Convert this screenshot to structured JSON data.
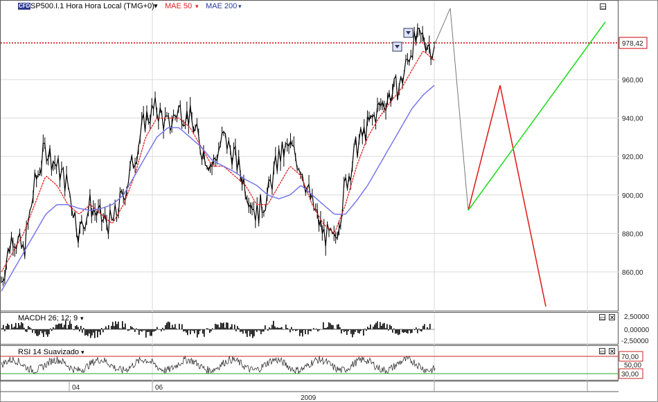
{
  "header": {
    "badge": "CFD",
    "symbol": "SP500.I.1 Hora Hora Local (TMG+0)",
    "ma1": "MAE 50",
    "ma2": "MAE 200"
  },
  "colors": {
    "price": "#000000",
    "ma50": "#e02020",
    "ma200": "#7777ee",
    "grid": "#d8d8d8",
    "current_line": "#cc0000",
    "grey_projection": "#777777",
    "red_projection": "#e02020",
    "green_projection": "#22dd22",
    "rsi_band_high": "#cc2222",
    "rsi_band_low": "#22aa22"
  },
  "price_panel": {
    "current_price": "978,42",
    "y_ticks": [
      "960,00",
      "940,00",
      "920,00",
      "900,00",
      "880,00",
      "860,00"
    ],
    "ylim": [
      845,
      1000
    ]
  },
  "macd_panel": {
    "title": "MACDH 26; 12; 9",
    "y_ticks": [
      "2,50000",
      "0,00000",
      "-2,50000"
    ]
  },
  "rsi_panel": {
    "title": "RSI 14 Suavizado",
    "y_ticks": [
      "70,00",
      "50,00",
      "30,00"
    ],
    "band_high": 70,
    "band_low": 30
  },
  "x_axis": {
    "ticks": [
      "04",
      "06"
    ],
    "year": "2009"
  },
  "chart_data": {
    "type": "line",
    "title": "SP500.I.1 Hora Hora Local (TMG+0)",
    "series": [
      {
        "name": "SP500.I.1",
        "values": [
          855,
          880,
          870,
          905,
          925,
          915,
          905,
          880,
          895,
          887,
          885,
          900,
          920,
          940,
          945,
          935,
          945,
          940,
          925,
          915,
          930,
          920,
          905,
          890,
          900,
          920,
          925,
          915,
          895,
          880,
          875,
          905,
          925,
          935,
          945,
          952,
          958,
          978,
          982,
          975
        ]
      },
      {
        "name": "MAE 50",
        "values": [
          860,
          870,
          880,
          895,
          910,
          905,
          895,
          890,
          895,
          890,
          885,
          895,
          910,
          930,
          940,
          940,
          940,
          935,
          925,
          915,
          915,
          910,
          905,
          895,
          895,
          905,
          915,
          910,
          895,
          885,
          880,
          895,
          915,
          930,
          940,
          948,
          955,
          965,
          975,
          970
        ]
      },
      {
        "name": "MAE 200",
        "values": [
          850,
          860,
          870,
          880,
          890,
          895,
          895,
          893,
          892,
          893,
          895,
          900,
          910,
          920,
          930,
          935,
          935,
          930,
          925,
          918,
          915,
          912,
          908,
          905,
          900,
          898,
          900,
          905,
          900,
          895,
          890,
          890,
          897,
          905,
          915,
          925,
          935,
          945,
          952,
          957
        ]
      }
    ],
    "projections": [
      {
        "color": "grey",
        "points": [
          [
            978,
            0
          ],
          [
            997,
            1
          ],
          [
            892,
            2
          ]
        ]
      },
      {
        "color": "red",
        "points": [
          [
            892,
            2
          ],
          [
            957,
            3
          ],
          [
            842,
            4
          ]
        ]
      },
      {
        "color": "green",
        "points": [
          [
            892,
            2
          ],
          [
            990,
            5
          ]
        ]
      }
    ],
    "ylim": [
      845,
      1000
    ]
  }
}
